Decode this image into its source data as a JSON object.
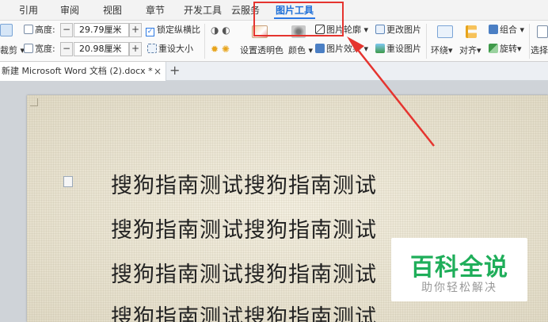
{
  "tabs": [
    "引用",
    "审阅",
    "视图",
    "章节",
    "开发工具",
    "云服务",
    "图片工具"
  ],
  "active_tab": "图片工具",
  "ribbon": {
    "crop_label": "裁剪",
    "height_label": "高度:",
    "height_value": "29.79厘米",
    "width_label": "宽度:",
    "width_value": "20.98厘米",
    "minus": "−",
    "plus": "+",
    "lock_ratio": "锁定纵横比",
    "reset_size": "重设大小",
    "set_transparent": "设置透明色",
    "color": "颜色",
    "picture_outline": "图片轮廓",
    "picture_effect": "图片效果",
    "change_picture": "更改图片",
    "reset_picture": "重设图片",
    "wrap": "环绕",
    "align": "对齐",
    "rotate": "旋转",
    "group": "组合",
    "select": "选择"
  },
  "doc_tab": {
    "title": "新建 Microsoft Word 文档 (2).docx *",
    "close": "×",
    "add": "+"
  },
  "document": {
    "lines": [
      "搜狗指南测试搜狗指南测试",
      "搜狗指南测试搜狗指南测试",
      "搜狗指南测试搜狗指南测试",
      "搜狗指南测试搜狗指南测试"
    ]
  },
  "watermark": {
    "title": "百科全说",
    "subtitle": "助你轻松解决"
  },
  "colors": {
    "accent": "#2b78e4",
    "highlight": "#e5342f",
    "watermark_green": "#1fae5a"
  }
}
